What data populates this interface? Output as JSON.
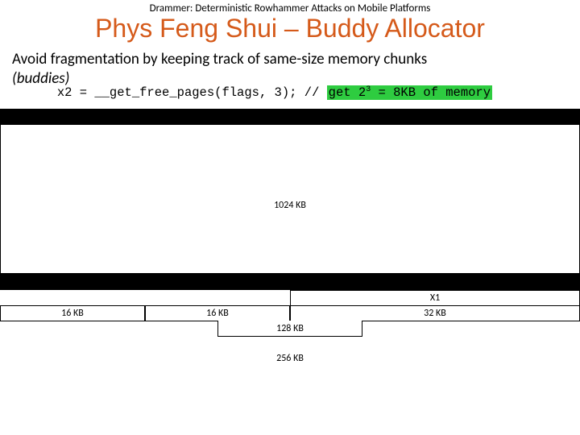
{
  "header": {
    "small": "Drammer: Deterministic Rowhammer Attacks on Mobile Platforms"
  },
  "title": "Phys Feng Shui – Buddy Allocator",
  "body": {
    "line": "Avoid fragmentation by keeping track of same-size memory chunks",
    "buddies": "(buddies)",
    "code_pre": "x2 = __get_free_pages(flags, 3); // ",
    "code_hl_a": "get 2",
    "code_hl_sup": "3",
    "code_hl_b": " = 8KB of memory"
  },
  "diagram": {
    "big_block": "1024 KB",
    "x1": "X1",
    "r_left_a": "16 KB",
    "r_left_b": "16 KB",
    "r_right": "32 KB",
    "r_128": "128 KB",
    "r_256": "256 KB"
  }
}
